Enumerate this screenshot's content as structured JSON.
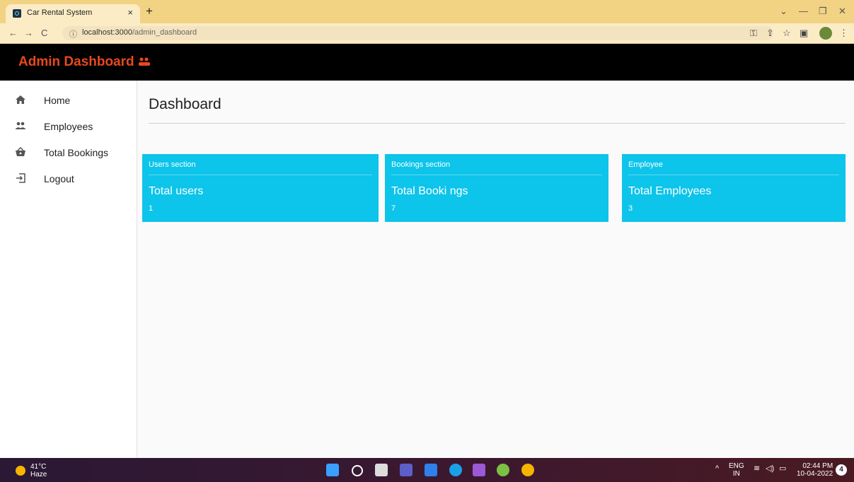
{
  "browser": {
    "tab_title": "Car Rental System",
    "tab_close": "×",
    "new_tab": "+",
    "url_host": "localhost:3000",
    "url_path": "/admin_dashboard",
    "win_min": "—",
    "win_restore": "❐",
    "win_close": "✕",
    "win_down": "⌄"
  },
  "appbar": {
    "brand": "Admin Dashboard"
  },
  "sidebar": {
    "items": [
      {
        "label": "Home",
        "icon": "home-icon"
      },
      {
        "label": "Employees",
        "icon": "people-icon"
      },
      {
        "label": "Total Bookings",
        "icon": "basket-icon"
      },
      {
        "label": "Logout",
        "icon": "logout-icon"
      }
    ]
  },
  "main": {
    "title": "Dashboard",
    "cards": [
      {
        "header": "Users section",
        "title": "Total users",
        "value": "1"
      },
      {
        "header": "Bookings section",
        "title": "Total Booki ngs",
        "value": "7"
      },
      {
        "header": "Employee",
        "title": "Total Employees",
        "value": "3"
      }
    ]
  },
  "taskbar": {
    "temp": "41°C",
    "weather": "Haze",
    "lang": "ENG",
    "region": "IN",
    "time": "02:44 PM",
    "date": "10-04-2022",
    "notifications": "4"
  },
  "colors": {
    "accent": "#0dc4ea",
    "brand": "#e8491d",
    "tabbar": "#f2d283"
  }
}
